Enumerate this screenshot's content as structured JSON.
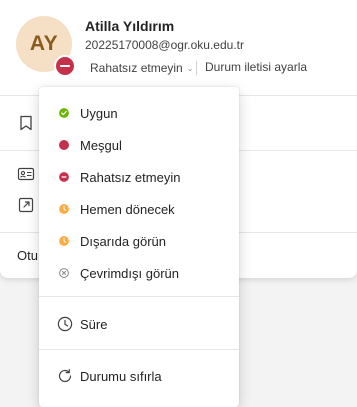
{
  "user": {
    "initials": "AY",
    "name": "Atilla Yıldırım",
    "email": "20225170008@ogr.oku.edu.tr",
    "status_label": "Rahatsız etmeyin",
    "status_chevron": "⌄",
    "status_message_link": "Durum iletisi ayarla",
    "presence_color": "#c4314b",
    "avatar_bg": "#f5dfc5"
  },
  "card": {
    "sign_out_label": "Otu"
  },
  "status_menu": {
    "items": [
      {
        "label": "Uygun",
        "icon": "available-icon",
        "color": "#6bb700"
      },
      {
        "label": "Meşgul",
        "icon": "busy-icon",
        "color": "#c4314b"
      },
      {
        "label": "Rahatsız etmeyin",
        "icon": "do-not-disturb-icon",
        "color": "#c4314b"
      },
      {
        "label": "Hemen dönecek",
        "icon": "be-right-back-icon",
        "color": "#ffaa44"
      },
      {
        "label": "Dışarıda görün",
        "icon": "away-icon",
        "color": "#ffaa44"
      },
      {
        "label": "Çevrimdışı görün",
        "icon": "offline-icon",
        "color": "#8a8a8a"
      }
    ],
    "duration_label": "Süre",
    "reset_label": "Durumu sıfırla"
  }
}
